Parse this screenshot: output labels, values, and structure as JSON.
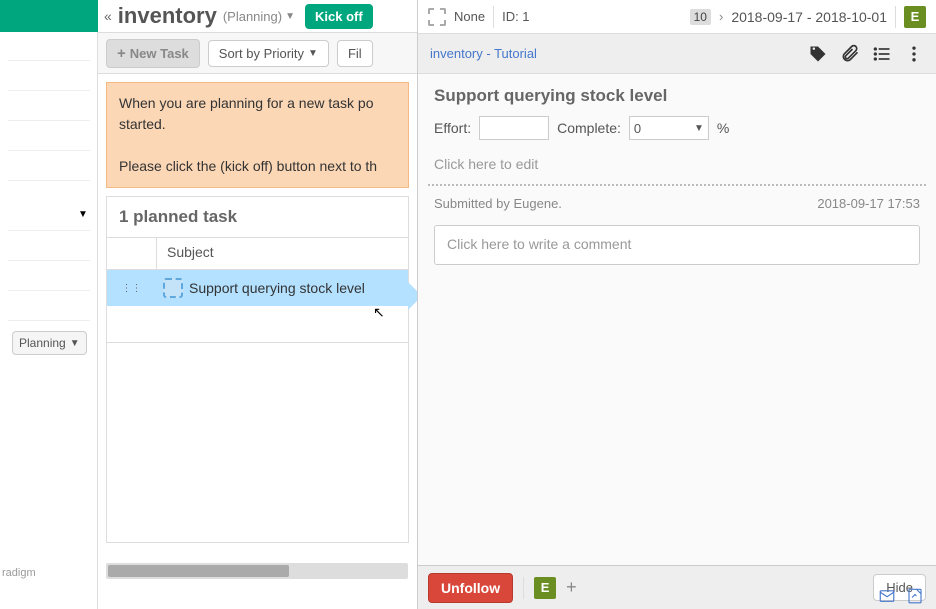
{
  "sidebar": {
    "planning_label": "Planning",
    "brand": "radigm"
  },
  "main": {
    "title": "inventory",
    "status": "(Planning)",
    "kickoff": "Kick off",
    "new_task": "New Task",
    "sort": "Sort by Priority",
    "filter": "Fil",
    "banner_line1": "When you are planning for a new task po",
    "banner_line2": "started.",
    "banner_line3": "Please click the (kick off) button next to th",
    "planned_header": "1 planned task",
    "col_subject": "Subject",
    "rows": [
      {
        "subject": "Support querying stock level"
      }
    ]
  },
  "panel": {
    "none": "None",
    "id_label": "ID: 1",
    "count": "10",
    "daterange": "2018-09-17 - 2018-10-01",
    "avatar": "E",
    "breadcrumb": "inventory - Tutorial",
    "title": "Support querying stock level",
    "effort_label": "Effort:",
    "complete_label": "Complete:",
    "complete_value": "0",
    "percent": "%",
    "desc_placeholder": "Click here to edit",
    "submitted": "Submitted by Eugene.",
    "timestamp": "2018-09-17 17:53",
    "comment_placeholder": "Click here to write a comment",
    "unfollow": "Unfollow",
    "hide": "Hide"
  }
}
